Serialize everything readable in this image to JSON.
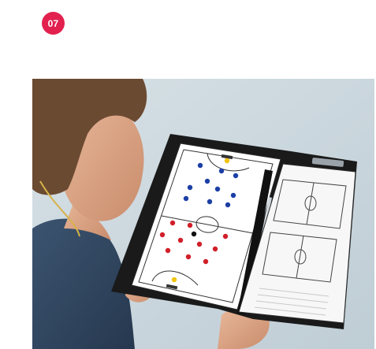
{
  "step_badge": {
    "label": "07",
    "color": "#e2214f"
  },
  "photo": {
    "subject": "coach-holding-tactic-folder",
    "left_board": "futsal-tactic-board",
    "right_board": "football-pitch-worksheet",
    "magnet_colors": {
      "team_a": "#1c3fa6",
      "team_b": "#d11f2a",
      "ball": "#111111",
      "goalkeeper": "#f1c40f"
    }
  }
}
